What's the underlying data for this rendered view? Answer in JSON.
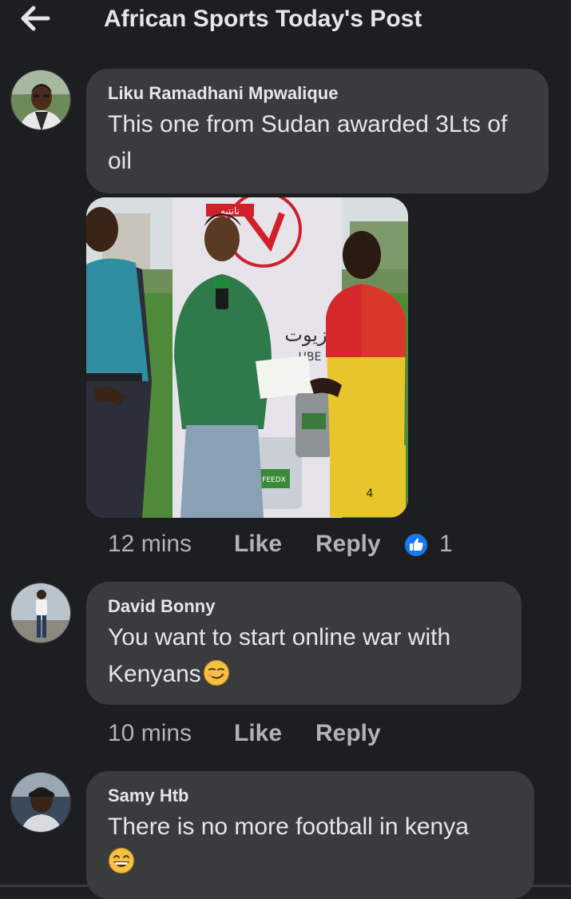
{
  "header": {
    "title": "African Sports Today's Post"
  },
  "comments": [
    {
      "author": "Liku Ramadhani Mpwalique",
      "text": "This one from Sudan awarded 3Lts of oil",
      "time": "12 mins",
      "like_label": "Like",
      "reply_label": "Reply",
      "reaction_count": "1",
      "photo": {
        "sign_text": "زيوت",
        "sign_sub": "UBE",
        "banner_text": "نانتيه",
        "jersey_number": "4",
        "can_label": "FEEDX"
      }
    },
    {
      "author": "David Bonny",
      "text": "You want to start online war with Kenyans",
      "emoji": "smirk-emoji",
      "time": "10 mins",
      "like_label": "Like",
      "reply_label": "Reply"
    },
    {
      "author": "Samy Htb",
      "text": "There is no more football in kenya",
      "emoji": "grinning-emoji"
    }
  ],
  "colors": {
    "background": "#1c1e21",
    "bubble": "#3a3b3c",
    "text": "#e4e6eb",
    "meta": "#b0b3b8",
    "like_badge": "#1877f2"
  }
}
